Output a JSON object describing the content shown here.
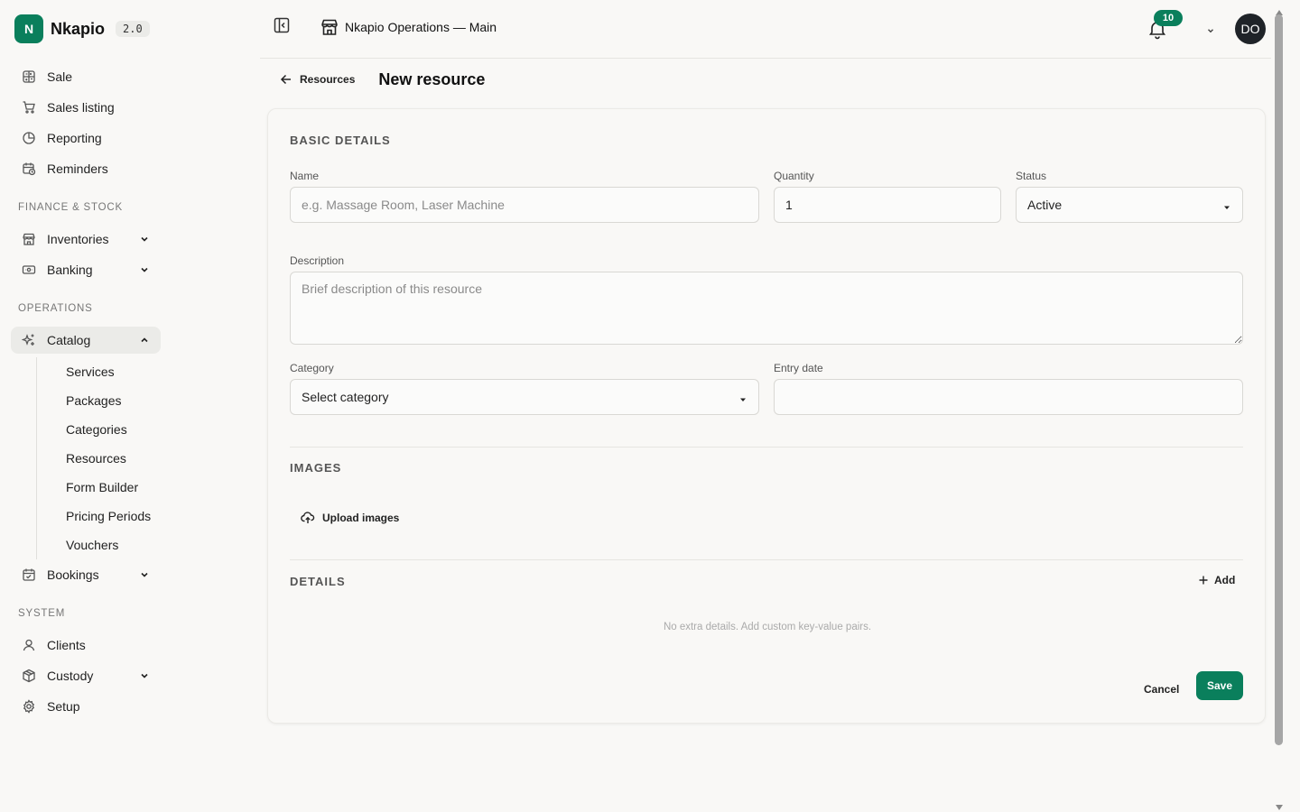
{
  "brand": {
    "logo_letter": "N",
    "name": "Nkapio",
    "version": "2.0"
  },
  "sidebar": {
    "top_items": [
      {
        "label": "Sale",
        "icon": "calculator-icon"
      },
      {
        "label": "Sales listing",
        "icon": "cart-icon"
      },
      {
        "label": "Reporting",
        "icon": "pie-chart-icon"
      },
      {
        "label": "Reminders",
        "icon": "calendar-clock-icon"
      }
    ],
    "finance_label": "FINANCE & STOCK",
    "finance_items": [
      {
        "label": "Inventories",
        "icon": "store-icon"
      },
      {
        "label": "Banking",
        "icon": "banknote-icon"
      }
    ],
    "operations_label": "OPERATIONS",
    "catalog": {
      "label": "Catalog",
      "icon": "sparkles-icon"
    },
    "catalog_children": [
      "Services",
      "Packages",
      "Categories",
      "Resources",
      "Form Builder",
      "Pricing Periods",
      "Vouchers"
    ],
    "bookings": {
      "label": "Bookings",
      "icon": "calendar-icon"
    },
    "system_label": "SYSTEM",
    "system_items": [
      {
        "label": "Clients",
        "icon": "user-icon"
      },
      {
        "label": "Custody",
        "icon": "package-icon"
      },
      {
        "label": "Setup",
        "icon": "gear-icon"
      }
    ]
  },
  "header": {
    "store_name": "Nkapio Operations — Main",
    "notifications_count": "10",
    "avatar_initials": "DO"
  },
  "breadcrumb": {
    "back_label": "Resources",
    "title": "New resource"
  },
  "form": {
    "basic_title": "BASIC DETAILS",
    "name_label": "Name",
    "name_placeholder": "e.g. Massage Room, Laser Machine",
    "name_value": "",
    "quantity_label": "Quantity",
    "quantity_value": "1",
    "status_label": "Status",
    "status_value": "Active",
    "description_label": "Description",
    "description_placeholder": "Brief description of this resource",
    "category_label": "Category",
    "category_value": "Select category",
    "entry_date_label": "Entry date",
    "entry_date_value": "",
    "images_title": "IMAGES",
    "upload_label": "Upload images",
    "details_title": "DETAILS",
    "add_label": "Add",
    "details_empty": "No extra details. Add custom key-value pairs.",
    "cancel_label": "Cancel",
    "save_label": "Save"
  },
  "colors": {
    "accent": "#0a7f5c",
    "avatar_bg": "#1f2328",
    "page_bg": "#f9f8f6"
  }
}
